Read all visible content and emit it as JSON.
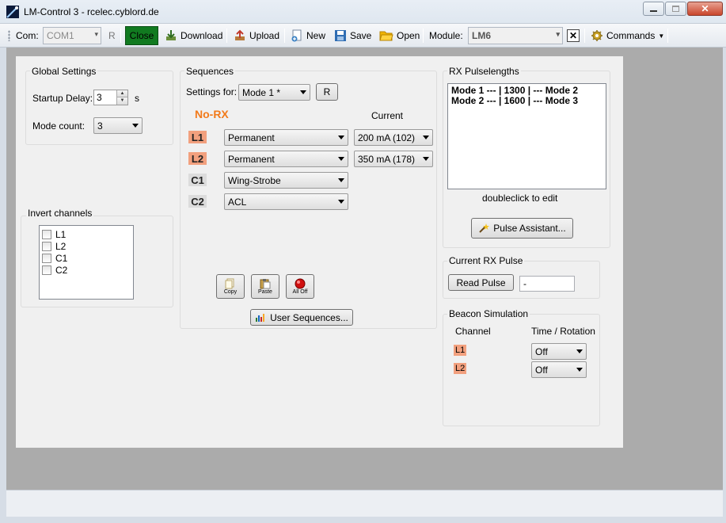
{
  "window": {
    "title": "LM-Control 3 - rcelec.cyblord.de"
  },
  "toolbar": {
    "com_label": "Com:",
    "com_value": "COM1",
    "refresh_label": "R",
    "close_label": "Close",
    "download_label": "Download",
    "upload_label": "Upload",
    "new_label": "New",
    "save_label": "Save",
    "open_label": "Open",
    "module_label": "Module:",
    "module_value": "LM6",
    "commands_label": "Commands"
  },
  "global_settings": {
    "title": "Global Settings",
    "startup_delay_label": "Startup Delay:",
    "startup_delay_value": "3",
    "startup_delay_unit": "s",
    "mode_count_label": "Mode count:",
    "mode_count_value": "3"
  },
  "invert_channels": {
    "title": "Invert channels",
    "items": [
      {
        "label": "L1",
        "checked": false
      },
      {
        "label": "L2",
        "checked": false
      },
      {
        "label": "C1",
        "checked": false
      },
      {
        "label": "C2",
        "checked": false
      }
    ]
  },
  "sequences": {
    "title": "Sequences",
    "settings_for_label": "Settings for:",
    "settings_for_value": "Mode 1 *",
    "r_button": "R",
    "no_rx_label": "No-RX",
    "current_label": "Current",
    "channels": [
      {
        "name": "L1",
        "kind": "l",
        "sequence": "Permanent",
        "current": "200 mA (102)"
      },
      {
        "name": "L2",
        "kind": "l",
        "sequence": "Permanent",
        "current": "350 mA (178)"
      },
      {
        "name": "C1",
        "kind": "c",
        "sequence": "Wing-Strobe",
        "current": ""
      },
      {
        "name": "C2",
        "kind": "c",
        "sequence": "ACL",
        "current": ""
      }
    ],
    "copy_label": "Copy",
    "paste_label": "Paste",
    "all_off_label": "All Off",
    "user_sequences_label": "User Sequences..."
  },
  "rx_pulselengths": {
    "title": "RX Pulselengths",
    "lines": [
      "Mode 1 --- | 1300 | --- Mode 2",
      "Mode 2 --- | 1600 | --- Mode 3"
    ],
    "hint": "doubleclick to edit",
    "pulse_assistant_label": "Pulse Assistant..."
  },
  "current_rx_pulse": {
    "title": "Current RX Pulse",
    "read_pulse_label": "Read Pulse",
    "value": "-"
  },
  "beacon_simulation": {
    "title": "Beacon Simulation",
    "channel_header": "Channel",
    "time_header": "Time / Rotation",
    "rows": [
      {
        "channel": "L1",
        "value": "Off"
      },
      {
        "channel": "L2",
        "value": "Off"
      }
    ]
  }
}
